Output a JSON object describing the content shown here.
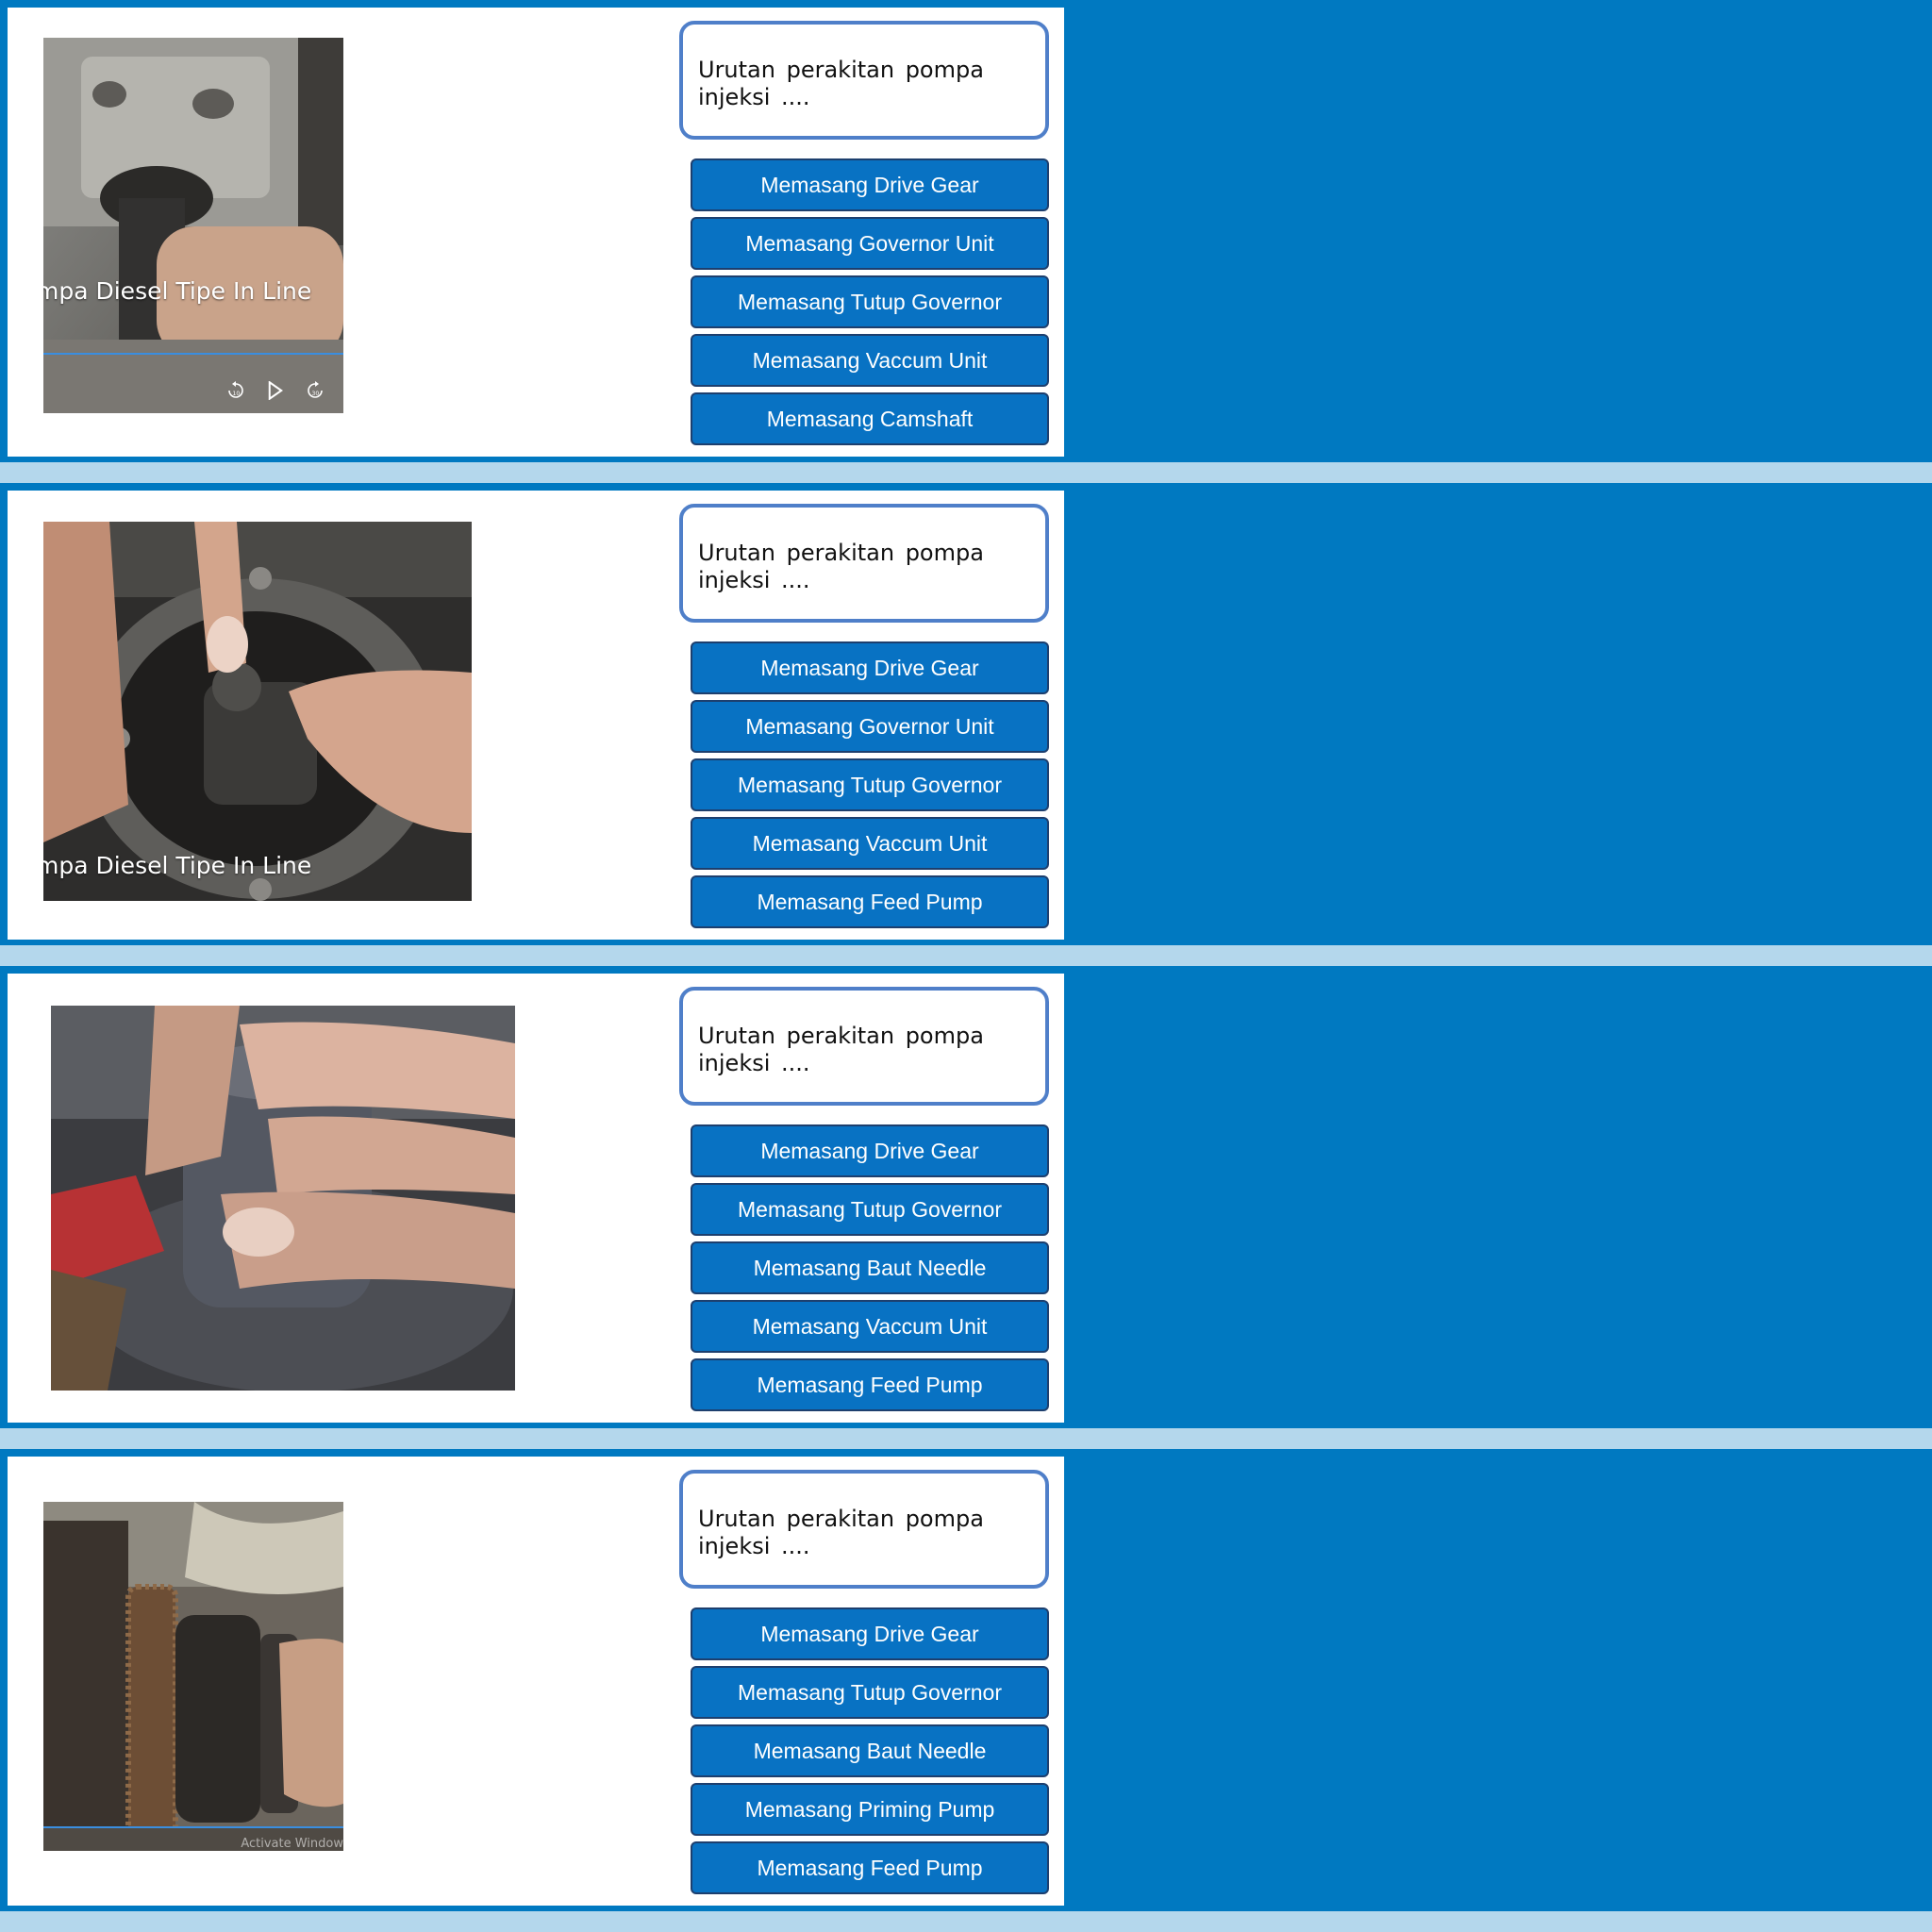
{
  "slides": [
    {
      "question": "Urutan perakitan pompa injeksi ....",
      "video_caption": "mpa Diesel Tipe In Line",
      "video_controls": {
        "rewind_seconds": "10",
        "forward_seconds": "30"
      },
      "answers": [
        "Memasang Drive Gear",
        "Memasang Governor Unit",
        "Memasang Tutup Governor",
        "Memasang Vaccum Unit",
        "Memasang Camshaft"
      ]
    },
    {
      "question": "Urutan perakitan pompa injeksi ....",
      "video_caption": "mpa Diesel Tipe In Line",
      "answers": [
        "Memasang Drive Gear",
        "Memasang Governor Unit",
        "Memasang Tutup Governor",
        "Memasang Vaccum Unit",
        "Memasang Feed Pump"
      ]
    },
    {
      "question": "Urutan perakitan pompa injeksi ....",
      "answers": [
        "Memasang Drive Gear",
        "Memasang Tutup Governor",
        "Memasang Baut Needle",
        "Memasang Vaccum Unit",
        "Memasang Feed Pump"
      ]
    },
    {
      "question": "Urutan perakitan pompa injeksi ....",
      "watermark": "Activate Window",
      "answers": [
        "Memasang Drive Gear",
        "Memasang Tutup Governor",
        "Memasang Baut Needle",
        "Memasang Priming Pump",
        "Memasang Feed Pump"
      ]
    }
  ],
  "colors": {
    "background": "#0079c1",
    "separator": "#b4d7ec",
    "answer_fill": "#0872c3",
    "question_border": "#4f7fc9"
  }
}
